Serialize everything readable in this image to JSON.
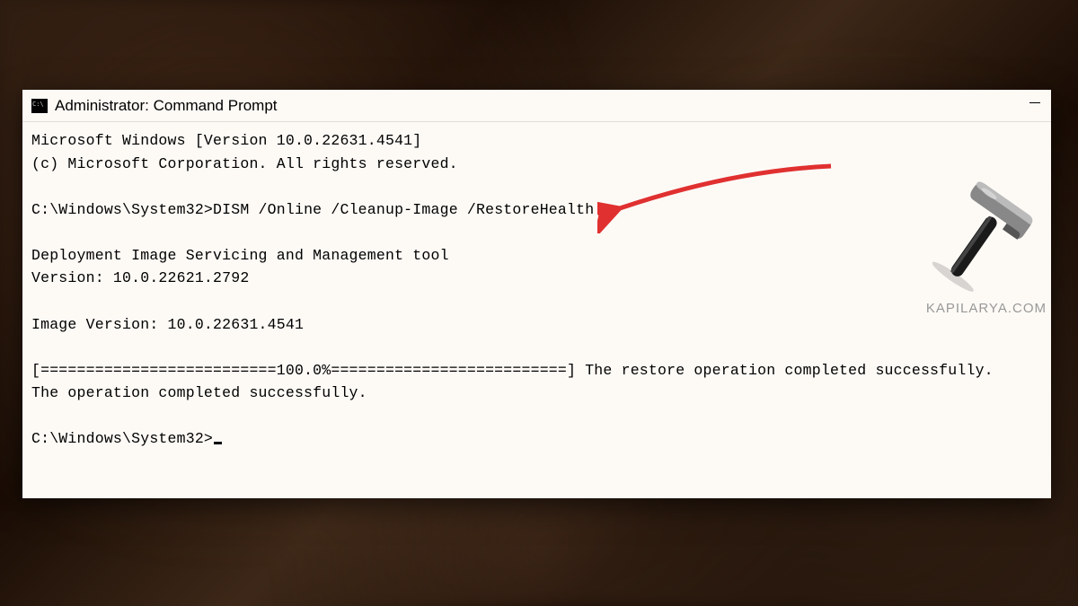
{
  "window": {
    "title": "Administrator: Command Prompt"
  },
  "terminal": {
    "line1": "Microsoft Windows [Version 10.0.22631.4541]",
    "line2": "(c) Microsoft Corporation. All rights reserved.",
    "line3": "",
    "prompt1": "C:\\Windows\\System32>",
    "command1": "DISM /Online /Cleanup-Image /RestoreHealth",
    "line5": "",
    "line6": "Deployment Image Servicing and Management tool",
    "line7": "Version: 10.0.22621.2792",
    "line8": "",
    "line9": "Image Version: 10.0.22631.4541",
    "line10": "",
    "line11": "[==========================100.0%==========================] The restore operation completed successfully.",
    "line12": "The operation completed successfully.",
    "line13": "",
    "prompt2": "C:\\Windows\\System32>"
  },
  "watermark": {
    "text": "KAPILARYA.COM"
  },
  "annotation": {
    "arrow_color": "#e03030"
  }
}
